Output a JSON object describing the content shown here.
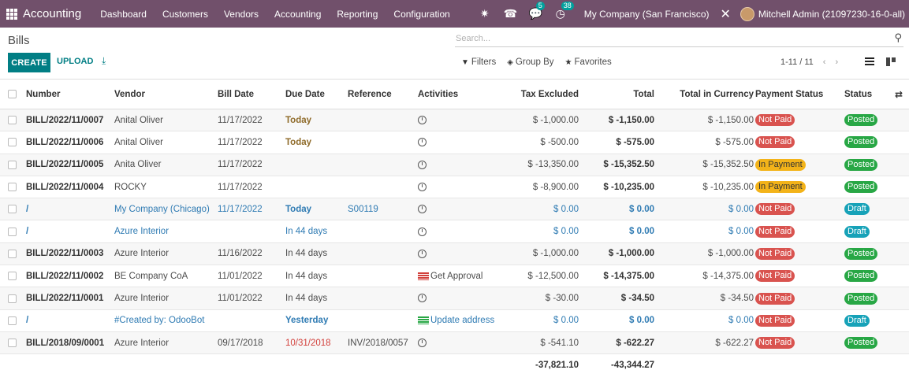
{
  "navbar": {
    "brand": "Accounting",
    "menu": [
      "Dashboard",
      "Customers",
      "Vendors",
      "Accounting",
      "Reporting",
      "Configuration"
    ],
    "messages_count": "5",
    "activities_count": "38",
    "company": "My Company (San Francisco)",
    "user": "Mitchell Admin (21097230-16-0-all)"
  },
  "control": {
    "title": "Bills",
    "search_placeholder": "Search...",
    "create_label": "CREATE",
    "upload_label": "UPLOAD",
    "filters_label": "Filters",
    "groupby_label": "Group By",
    "favorites_label": "Favorites",
    "pager": "1-11 / 11"
  },
  "table": {
    "headers": {
      "number": "Number",
      "vendor": "Vendor",
      "bill_date": "Bill Date",
      "due_date": "Due Date",
      "reference": "Reference",
      "activities": "Activities",
      "tax_excluded": "Tax Excluded",
      "total": "Total",
      "total_currency": "Total in Currency",
      "payment_status": "Payment Status",
      "status": "Status"
    },
    "rows": [
      {
        "number": "BILL/2022/11/0007",
        "vendor": "Anital Oliver",
        "bill_date": "11/17/2022",
        "due": "Today",
        "ref": "",
        "activity": "",
        "tax": "$ -1,000.00",
        "total": "$ -1,150.00",
        "cur": "$ -1,150.00",
        "payment": "Not Paid",
        "status": "Posted"
      },
      {
        "number": "BILL/2022/11/0006",
        "vendor": "Anital Oliver",
        "bill_date": "11/17/2022",
        "due": "Today",
        "ref": "",
        "activity": "",
        "tax": "$ -500.00",
        "total": "$ -575.00",
        "cur": "$ -575.00",
        "payment": "Not Paid",
        "status": "Posted"
      },
      {
        "number": "BILL/2022/11/0005",
        "vendor": "Anita Oliver",
        "bill_date": "11/17/2022",
        "due": "",
        "ref": "",
        "activity": "",
        "tax": "$ -13,350.00",
        "total": "$ -15,352.50",
        "cur": "$ -15,352.50",
        "payment": "In Payment",
        "status": "Posted"
      },
      {
        "number": "BILL/2022/11/0004",
        "vendor": "ROCKY",
        "bill_date": "11/17/2022",
        "due": "",
        "ref": "",
        "activity": "",
        "tax": "$ -8,900.00",
        "total": "$ -10,235.00",
        "cur": "$ -10,235.00",
        "payment": "In Payment",
        "status": "Posted"
      },
      {
        "number": "/",
        "vendor": "My Company (Chicago)",
        "bill_date": "11/17/2022",
        "due": "Today",
        "ref": "S00119",
        "activity": "",
        "tax": "$ 0.00",
        "total": "$ 0.00",
        "cur": "$ 0.00",
        "payment": "Not Paid",
        "status": "Draft"
      },
      {
        "number": "/",
        "vendor": "Azure Interior",
        "bill_date": "",
        "due": "In 44 days",
        "ref": "",
        "activity": "",
        "tax": "$ 0.00",
        "total": "$ 0.00",
        "cur": "$ 0.00",
        "payment": "Not Paid",
        "status": "Draft"
      },
      {
        "number": "BILL/2022/11/0003",
        "vendor": "Azure Interior",
        "bill_date": "11/16/2022",
        "due": "In 44 days",
        "ref": "",
        "activity": "",
        "tax": "$ -1,000.00",
        "total": "$ -1,000.00",
        "cur": "$ -1,000.00",
        "payment": "Not Paid",
        "status": "Posted"
      },
      {
        "number": "BILL/2022/11/0002",
        "vendor": "BE Company CoA",
        "bill_date": "11/01/2022",
        "due": "In 44 days",
        "ref": "",
        "activity": "Get Approval",
        "tax": "$ -12,500.00",
        "total": "$ -14,375.00",
        "cur": "$ -14,375.00",
        "payment": "Not Paid",
        "status": "Posted"
      },
      {
        "number": "BILL/2022/11/0001",
        "vendor": "Azure Interior",
        "bill_date": "11/01/2022",
        "due": "In 44 days",
        "ref": "",
        "activity": "",
        "tax": "$ -30.00",
        "total": "$ -34.50",
        "cur": "$ -34.50",
        "payment": "Not Paid",
        "status": "Posted"
      },
      {
        "number": "/",
        "vendor": "#Created by: OdooBot",
        "bill_date": "",
        "due": "Yesterday",
        "ref": "",
        "activity": "Update address",
        "tax": "$ 0.00",
        "total": "$ 0.00",
        "cur": "$ 0.00",
        "payment": "Not Paid",
        "status": "Draft"
      },
      {
        "number": "BILL/2018/09/0001",
        "vendor": "Azure Interior",
        "bill_date": "09/17/2018",
        "due": "10/31/2018",
        "ref": "INV/2018/0057",
        "activity": "",
        "tax": "$ -541.10",
        "total": "$ -622.27",
        "cur": "$ -622.27",
        "payment": "Not Paid",
        "status": "Posted"
      }
    ],
    "totals": {
      "tax": "-37,821.10",
      "total": "-43,344.27"
    }
  },
  "colors": {
    "navbar": "#71506b",
    "primary": "#017e84",
    "not_paid": "#d9534f",
    "in_payment": "#f3b319",
    "posted": "#28a745",
    "draft": "#17a2b8"
  }
}
